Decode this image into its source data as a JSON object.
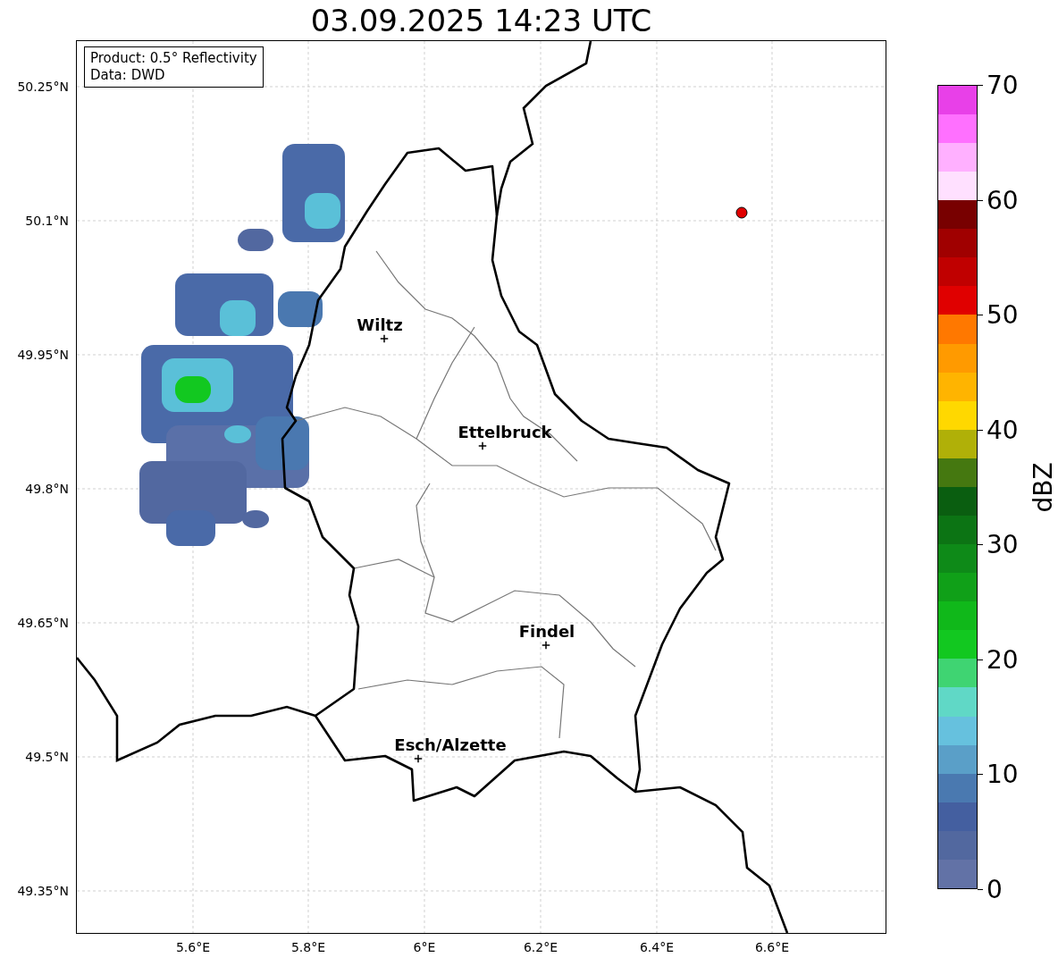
{
  "title": "03.09.2025 14:23 UTC",
  "info_box": [
    "Product: 0.5° Reflectivity",
    "Data: DWD"
  ],
  "y_ticks": [
    "50.25°N",
    "50.1°N",
    "49.95°N",
    "49.8°N",
    "49.65°N",
    "49.5°N",
    "49.35°N"
  ],
  "x_ticks": [
    "5.6°E",
    "5.8°E",
    "6°E",
    "6.2°E",
    "6.4°E",
    "6.6°E"
  ],
  "cities": [
    {
      "name": "Wiltz"
    },
    {
      "name": "Ettelbruck"
    },
    {
      "name": "Findel"
    },
    {
      "name": "Esch/Alzette"
    }
  ],
  "colorbar": {
    "label": "dBZ",
    "ticks": [
      "70",
      "60",
      "50",
      "40",
      "30",
      "20",
      "10",
      "0"
    ],
    "segments": [
      {
        "color": "#6272a6"
      },
      {
        "color": "#52689f"
      },
      {
        "color": "#445fa0"
      },
      {
        "color": "#4a79b0"
      },
      {
        "color": "#5a9fc8"
      },
      {
        "color": "#66c1de"
      },
      {
        "color": "#60d8c6"
      },
      {
        "color": "#3fd472"
      },
      {
        "color": "#12c820"
      },
      {
        "color": "#10b81a"
      },
      {
        "color": "#10a018"
      },
      {
        "color": "#0e8a18"
      },
      {
        "color": "#0c7414"
      },
      {
        "color": "#0a5e10"
      },
      {
        "color": "#457810"
      },
      {
        "color": "#b0b008"
      },
      {
        "color": "#ffd800"
      },
      {
        "color": "#ffb400"
      },
      {
        "color": "#ff9a00"
      },
      {
        "color": "#ff7800"
      },
      {
        "color": "#e00000"
      },
      {
        "color": "#c00000"
      },
      {
        "color": "#a00000"
      },
      {
        "color": "#780000"
      },
      {
        "color": "#ffe0ff"
      },
      {
        "color": "#ffb0ff"
      },
      {
        "color": "#ff70ff"
      },
      {
        "color": "#e840e8"
      }
    ]
  }
}
